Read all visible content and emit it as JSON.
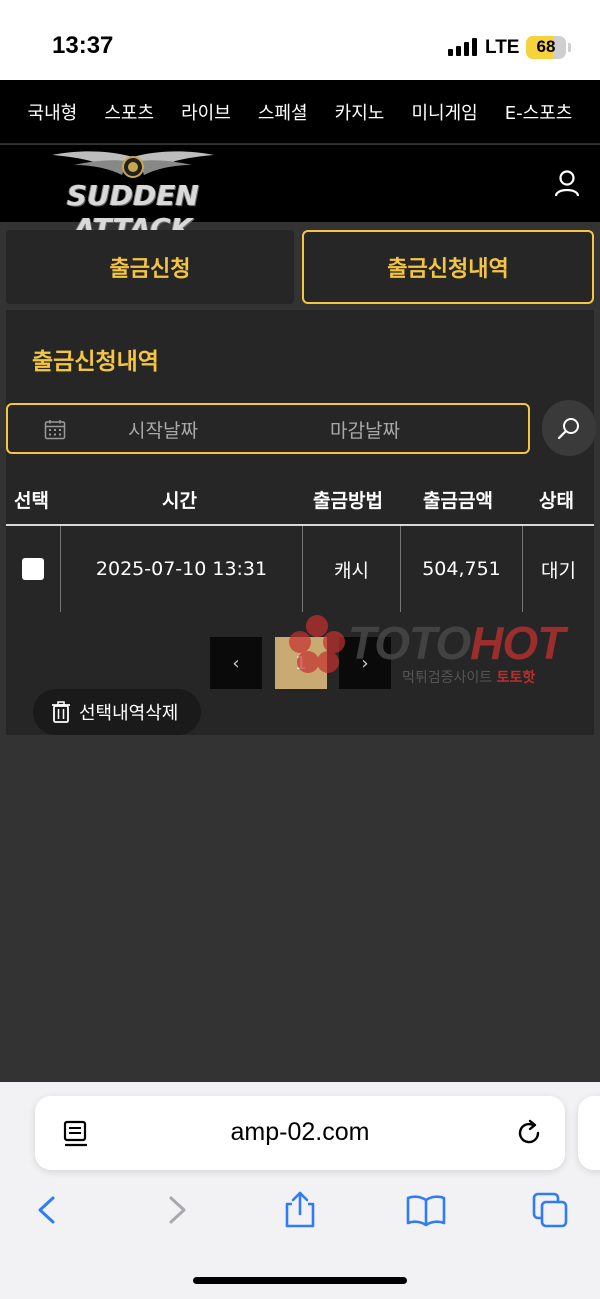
{
  "status_bar": {
    "time": "13:37",
    "network": "LTE",
    "battery": "68",
    "battery_level_pct": 68
  },
  "top_nav": {
    "items": [
      "국내형",
      "스포츠",
      "라이브",
      "스페셜",
      "카지노",
      "미니게임",
      "E-스포츠"
    ]
  },
  "header": {
    "logo_text": "SUDDEN ATTACK",
    "user_icon": "user-icon"
  },
  "tabs": [
    {
      "label": "출금신청",
      "active": false
    },
    {
      "label": "출금신청내역",
      "active": true
    }
  ],
  "panel": {
    "title": "출금신청내역",
    "date_filter": {
      "start_placeholder": "시작날짜",
      "end_placeholder": "마감날짜"
    },
    "table": {
      "headers": [
        "선택",
        "시간",
        "출금방법",
        "출금금액",
        "상태"
      ],
      "rows": [
        {
          "time": "2025-07-10 13:31",
          "method": "캐시",
          "amount": "504,751",
          "status": "대기"
        }
      ]
    },
    "pagination": {
      "prev": "‹",
      "current": "1",
      "next": "›"
    },
    "delete_button": "선택내역삭제"
  },
  "watermark": {
    "brand_left": "TOTO",
    "brand_right": "HOT",
    "sub_left": "먹튀검증사이트",
    "sub_right": "토토핫"
  },
  "browser": {
    "url": "amp-02.com"
  },
  "colors": {
    "accent": "#f5c542",
    "background": "#333333",
    "panel": "#262626"
  }
}
